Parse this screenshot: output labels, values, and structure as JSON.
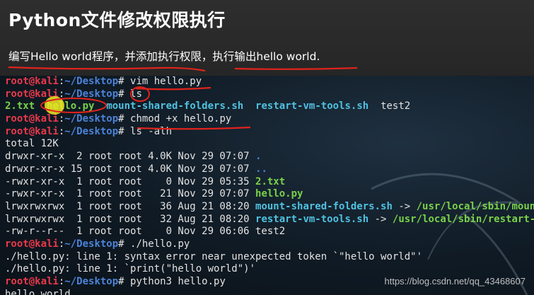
{
  "slide": {
    "title": "Python文件修改权限执行",
    "subtitle": "编写Hello world程序，并添加执行权限，执行输出hello world."
  },
  "terminal": {
    "user": "root@kali",
    "path": "~/Desktop",
    "lines": [
      {
        "type": "prompt",
        "cmd": "vim hello.py"
      },
      {
        "type": "prompt",
        "cmd": "ls"
      },
      {
        "type": "ls",
        "items": [
          {
            "text": "2.txt",
            "cls": "grn"
          },
          {
            "text": "  "
          },
          {
            "text": "hello.py",
            "cls": "grn"
          },
          {
            "text": "  "
          },
          {
            "text": "mount-shared-folders.sh",
            "cls": "cyn"
          },
          {
            "text": "  "
          },
          {
            "text": "restart-vm-tools.sh",
            "cls": "cyn"
          },
          {
            "text": "  "
          },
          {
            "text": "test2"
          }
        ]
      },
      {
        "type": "prompt",
        "cmd": "chmod +x hello.py"
      },
      {
        "type": "prompt",
        "cmd": "ls -alh"
      },
      {
        "type": "text",
        "text": "total 12K"
      },
      {
        "type": "ls",
        "items": [
          {
            "text": "drwxr-xr-x  2 root root 4.0K Nov 29 07:07 "
          },
          {
            "text": ".",
            "cls": "blu"
          }
        ]
      },
      {
        "type": "ls",
        "items": [
          {
            "text": "drwxr-xr-x 15 root root 4.0K Nov 29 07:07 "
          },
          {
            "text": "..",
            "cls": "blu"
          }
        ]
      },
      {
        "type": "ls",
        "items": [
          {
            "text": "-rwxr-xr-x  1 root root    0 Nov 29 05:35 "
          },
          {
            "text": "2.txt",
            "cls": "grn"
          }
        ]
      },
      {
        "type": "ls",
        "items": [
          {
            "text": "-rwxr-xr-x  1 root root   21 Nov 29 07:07 "
          },
          {
            "text": "hello.py",
            "cls": "grn"
          }
        ]
      },
      {
        "type": "ls",
        "items": [
          {
            "text": "lrwxrwxrwx  1 root root   36 Aug 21 08:20 "
          },
          {
            "text": "mount-shared-folders.sh",
            "cls": "cyn"
          },
          {
            "text": " -> "
          },
          {
            "text": "/usr/local/sbin/mount-shared-folders",
            "cls": "grn"
          }
        ]
      },
      {
        "type": "ls",
        "items": [
          {
            "text": "lrwxrwxrwx  1 root root   32 Aug 21 08:20 "
          },
          {
            "text": "restart-vm-tools.sh",
            "cls": "cyn"
          },
          {
            "text": " -> "
          },
          {
            "text": "/usr/local/sbin/restart-vm-tools",
            "cls": "grn"
          }
        ]
      },
      {
        "type": "text",
        "text": "-rw-r--r--  1 root root    0 Nov 29 06:06 test2"
      },
      {
        "type": "prompt",
        "cmd": "./hello.py"
      },
      {
        "type": "text",
        "text": "./hello.py: line 1: syntax error near unexpected token `\"hello world\"'"
      },
      {
        "type": "text",
        "text": "./hello.py: line 1: `print(\"hello world\")'"
      },
      {
        "type": "prompt",
        "cmd": "python3 hello.py"
      },
      {
        "type": "text",
        "text": "hello world"
      }
    ]
  },
  "watermark": "https://blog.csdn.net/qq_43468607",
  "colors": {
    "user": "#e8394b",
    "path": "#4b83d9",
    "exec": "#79d14a",
    "link": "#4fc1e0",
    "annotation": "#e0231c",
    "highlighter": "#f2ea22"
  }
}
